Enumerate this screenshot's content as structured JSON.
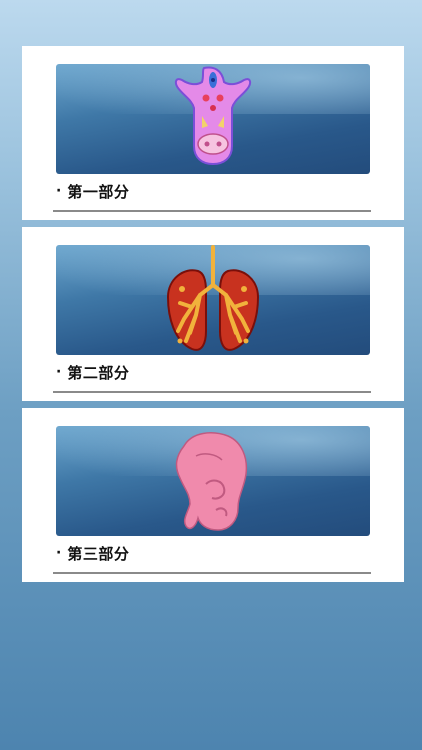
{
  "sections": [
    {
      "bullet": "·",
      "title": "第一部分",
      "image": "embryo-cross-section-illustration"
    },
    {
      "bullet": "·",
      "title": "第二部分",
      "image": "lungs-bronchi-illustration"
    },
    {
      "bullet": "·",
      "title": "第三部分",
      "image": "embryo-side-view-illustration"
    }
  ],
  "colors": {
    "background_top": "#bcd9ee",
    "background_bottom": "#4d84af",
    "card": "#ffffff",
    "thumbnail_blue": "#29588a",
    "divider": "#8a8a8a"
  }
}
